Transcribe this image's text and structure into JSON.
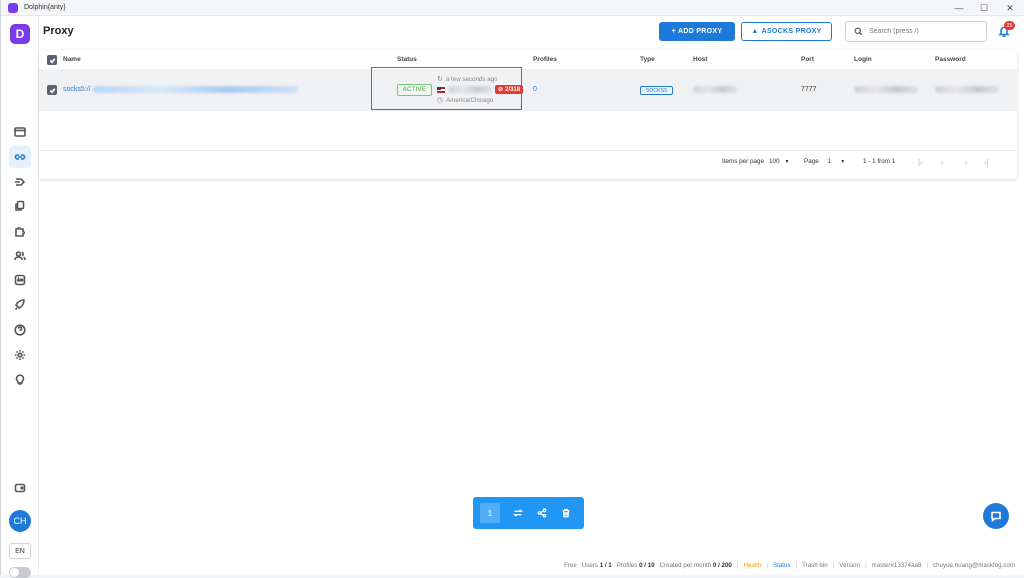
{
  "window": {
    "title": "Dolphin{anty}",
    "minimize": "—",
    "maximize": "☐",
    "close": "✕"
  },
  "sidebar": {
    "logo": "D",
    "avatar": "CH",
    "lang": "EN"
  },
  "header": {
    "title": "Proxy",
    "add_proxy": "+ ADD PROXY",
    "asocks_proxy": "ASOCKS PROXY",
    "search_placeholder": "Search (press /)",
    "notifications_count": "25"
  },
  "table": {
    "columns": {
      "name": "Name",
      "status": "Status",
      "profiles": "Profiles",
      "type": "Type",
      "host": "Host",
      "port": "Port",
      "login": "Login",
      "password": "Password"
    },
    "rows": [
      {
        "name_prefix": "socks5://",
        "status": "ACTIVE",
        "last_check": "a few seconds ago",
        "ip_badge": "2/318",
        "timezone": "America/Chicago",
        "profiles": "0",
        "type": "SOCKS5",
        "port": "7777"
      }
    ],
    "pagination": {
      "items_per_page_label": "Items per page",
      "items_per_page": "100",
      "page_label": "Page",
      "page": "1",
      "range": "1 - 1 from 1"
    }
  },
  "toolbar": {
    "selected_count": "1"
  },
  "footer": {
    "plan": "Free",
    "users_label": "Users",
    "users_value": "1 / 1",
    "profiles_label": "Profiles",
    "profiles_value": "0 / 10",
    "created_label": "Created per month",
    "created_value": "0 / 200",
    "health": "Health",
    "status": "Status",
    "trash": "Trash bin",
    "version": "Version",
    "build": "master#13374aa8",
    "email": "chuyue.huang@maskfog.com"
  },
  "colors": {
    "accent": "#1e7ad8",
    "brand": "#7c3aed",
    "danger": "#e53935",
    "success": "#43a047",
    "health": "#f59e0b"
  }
}
